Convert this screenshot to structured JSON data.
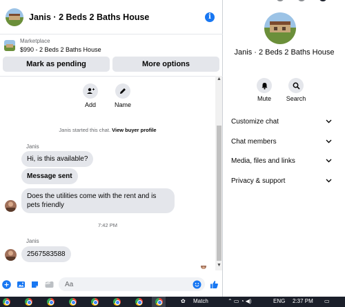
{
  "chat": {
    "title": "Janis · 2 Beds 2 Baths House",
    "info_icon": "i",
    "marketplace_label": "Marketplace",
    "listing": "$990 - 2 Beds 2 Baths House",
    "btn_pending": "Mark as pending",
    "btn_more": "More options",
    "action_add": "Add",
    "action_name": "Name",
    "started_text": "Janis started this chat.",
    "started_link": "View buyer profile",
    "messages": [
      {
        "sender": "Janis",
        "text": "Hi, is this available?"
      },
      {
        "text": "Message sent"
      },
      {
        "text": "Does the utilities come with the rent and is pets friendly"
      },
      {
        "time": "7:42 PM"
      },
      {
        "sender": "Janis",
        "text": "2567583588"
      }
    ],
    "composer_placeholder": "Aa",
    "gif_label": "GIF"
  },
  "details": {
    "title": "Janis · 2 Beds 2 Baths House",
    "mute": "Mute",
    "search": "Search",
    "menu": [
      "Customize chat",
      "Chat members",
      "Media, files and links",
      "Privacy & support"
    ]
  },
  "taskbar": {
    "match_label": "Match",
    "lang": "ENG",
    "time": "2:37 PM"
  },
  "colors": {
    "accent": "#1877f2",
    "bubble": "#e4e6eb",
    "taskbar": "#1b1f2a"
  }
}
